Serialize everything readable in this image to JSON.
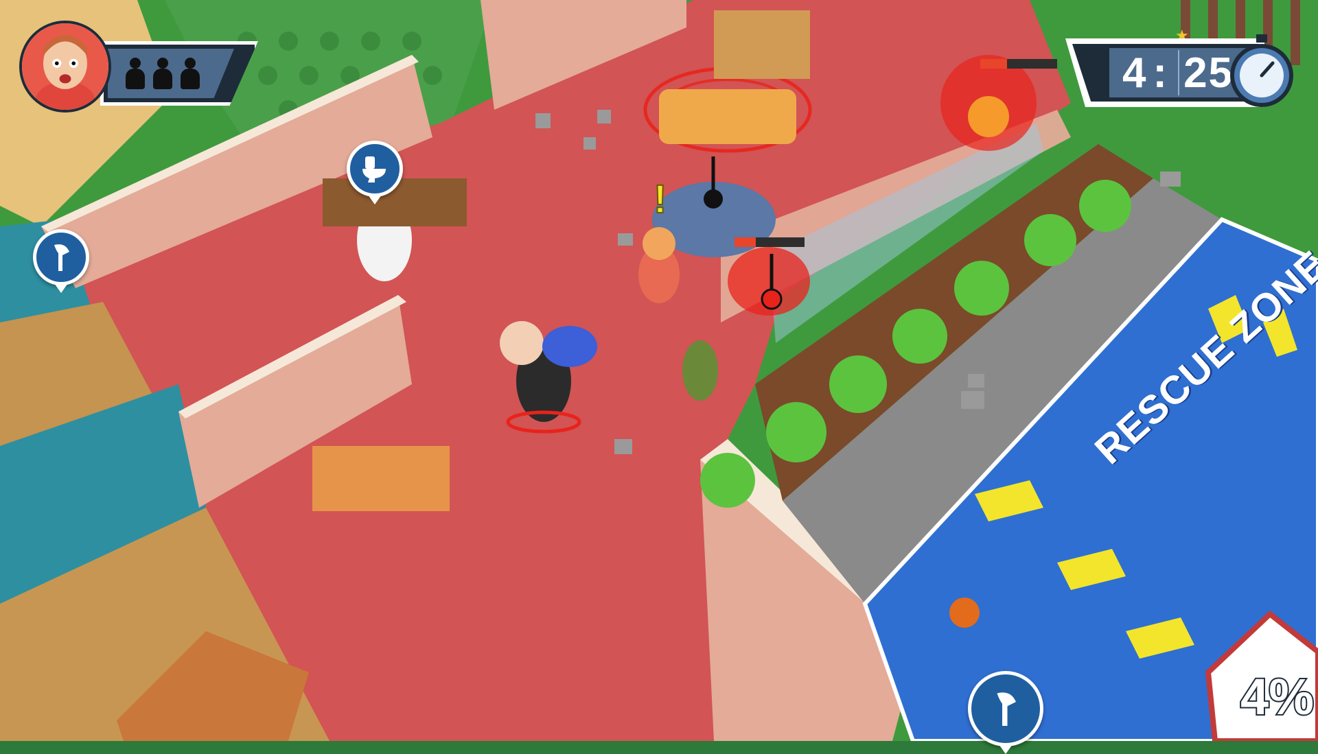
{
  "hud": {
    "lives": [
      1,
      1,
      1
    ],
    "timer": {
      "minutes": "4",
      "separator": ":",
      "seconds": "25"
    },
    "rescue_percent": "4%",
    "rescue_zone_label": "RESCUE ZONE",
    "bubbles": [
      {
        "name": "toilet-hint-bubble",
        "icon": "toilet-icon"
      },
      {
        "name": "axe-hint-bubble-left",
        "icon": "axe-icon"
      },
      {
        "name": "axe-ability-button",
        "icon": "axe-icon"
      }
    ],
    "fire_meters": [
      {
        "name": "sofa-fire-heat-meter",
        "level": 0.0
      },
      {
        "name": "room-fire-heat-meter",
        "level": 0.3
      },
      {
        "name": "wall-fire-heat-meter",
        "level": 0.35
      }
    ]
  },
  "colors": {
    "hud_navy": "#1e2c3a",
    "hud_blue": "#4c6a8c",
    "floor_red": "#d25454",
    "court_blue": "#2f6fd1",
    "fire": "#e8452a",
    "wall": "#e8b5a3"
  }
}
